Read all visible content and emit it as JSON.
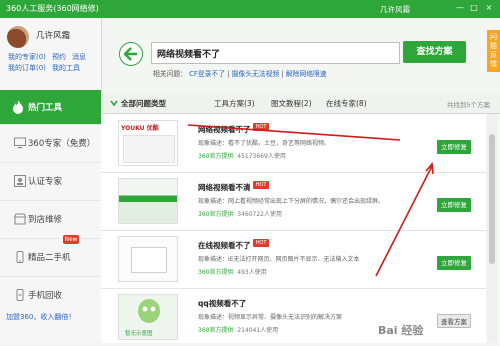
{
  "titlebar": {
    "title": "360人工服务(360网络修)",
    "user": "几许风霜",
    "min": "—",
    "max": "□",
    "close": "×"
  },
  "sidebar": {
    "user_name": "几许风霜",
    "links": [
      "我的专家(0)",
      "预约",
      "消息",
      "我的订单(0)",
      "我的工具"
    ],
    "nav": [
      {
        "label": "热门工具",
        "icon": "fire-icon",
        "active": true
      },
      {
        "label": "360专家（免费）",
        "icon": "monitor-icon"
      },
      {
        "label": "认证专家",
        "icon": "user-icon"
      },
      {
        "label": "到店维修",
        "icon": "shop-icon"
      },
      {
        "label": "精品二手机",
        "icon": "phone-icon",
        "badge": "New"
      },
      {
        "label": "手机回收",
        "icon": "recycle-icon"
      }
    ],
    "bottom_link": "加盟360，收入翻倍！"
  },
  "search": {
    "value": "网络视频看不了",
    "button": "查找方案"
  },
  "related": {
    "label": "相关问题：",
    "items": [
      "CF登录不了",
      "摄像头无法视频",
      "解除网络限速"
    ]
  },
  "side_tab": "问题反馈",
  "tabs": {
    "items": [
      "全部问题类型",
      "工具方案(3)",
      "图文教程(2)",
      "在线专家(8)"
    ],
    "count": "共找到5个方案"
  },
  "results": [
    {
      "title": "网络视频看不了",
      "hot": "HOT",
      "desc": "现象描述：看不了优酷，土豆，奇艺等网络视频。",
      "source": "360官方提供",
      "users": "45173669人使用",
      "button": "立即修复",
      "thumb_label": "YOUKU 优酷"
    },
    {
      "title": "网络视频看不清",
      "hot": "HOT",
      "desc": "现象描述：网上看视频经常出现上下分屏的情况，偶尔还会出现绿屏。",
      "source": "360官方提供",
      "users": "3460722人使用",
      "button": "立即修复"
    },
    {
      "title": "在线视频看不了",
      "hot": "HOT",
      "desc": "现象描述：IE无法打开网页、网页图片不显示、无法输入文本",
      "source": "360官方提供",
      "users": "493人使用",
      "button": "立即修复"
    },
    {
      "title": "qq视频看不了",
      "hot": "",
      "desc": "现象描述：视频显示异常、摄像头无法识别的解决方案",
      "source": "360官方提供",
      "users": "214041人使用",
      "button": "查看方案",
      "thumb_label": "暂无示意图"
    }
  ],
  "watermark": "Bai 经验",
  "colors": {
    "brand": "#2fa63a",
    "hot": "#e23b2a",
    "link": "#2b66c3",
    "annotation": "#d01a1a"
  }
}
